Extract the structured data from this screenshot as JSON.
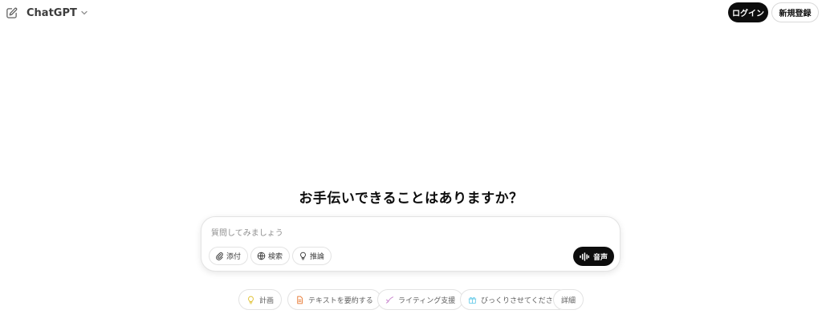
{
  "header": {
    "model_name": "ChatGPT",
    "login_label": "ログイン",
    "signup_label": "新規登録"
  },
  "main": {
    "heading": "お手伝いできることはありますか？"
  },
  "composer": {
    "placeholder": "質問してみましょう",
    "tools": [
      {
        "label": "添付",
        "icon": "paperclip-icon"
      },
      {
        "label": "検索",
        "icon": "globe-icon"
      },
      {
        "label": "推論",
        "icon": "lightbulb-icon"
      }
    ],
    "voice_label": "音声"
  },
  "suggestions": [
    {
      "label": "計画",
      "icon": "lightbulb-icon",
      "color": "#e2c541"
    },
    {
      "label": "テキストを要約する",
      "icon": "document-icon",
      "color": "#ea8444"
    },
    {
      "label": "ライティング支援",
      "icon": "pen-icon",
      "color": "#cb8bd0"
    },
    {
      "label": "びっくりさせてください",
      "icon": "gift-icon",
      "color": "#76d0eb"
    },
    {
      "label": "詳細",
      "icon": "",
      "color": ""
    }
  ]
}
